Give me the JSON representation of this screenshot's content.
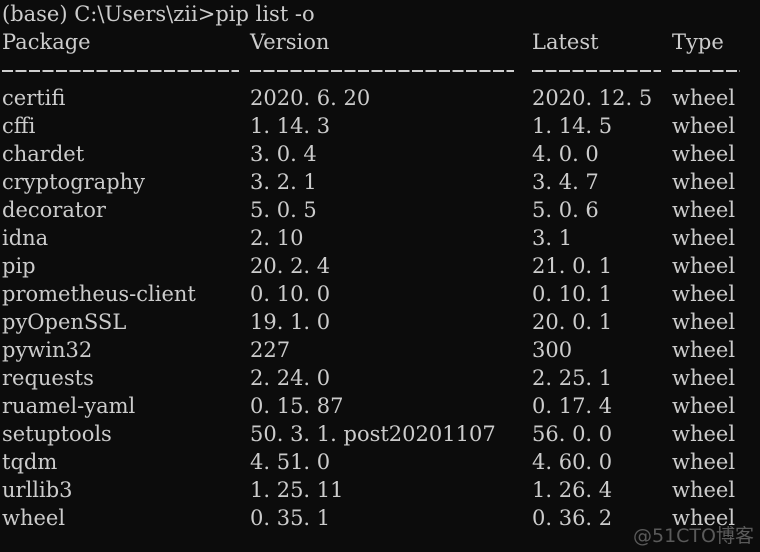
{
  "terminal": {
    "background_color": "#0c0c0c",
    "text_color": "#cccccc",
    "prompt_line": "(base) C:\\Users\\zii>pip list -o",
    "prompt_env": "(base)",
    "prompt_path": "C:\\Users\\zii",
    "command": "pip list -o"
  },
  "table": {
    "headers": {
      "package": "Package",
      "version": "Version",
      "latest": "Latest",
      "type": "Type"
    },
    "separators": {
      "package": "-------------------",
      "version": "---------------------",
      "latest": "----------",
      "type": "-----"
    },
    "rows": [
      {
        "package": "certifi",
        "version": "2020. 6. 20",
        "latest": "2020. 12. 5",
        "type": "wheel"
      },
      {
        "package": "cffi",
        "version": "1. 14. 3",
        "latest": "1. 14. 5",
        "type": "wheel"
      },
      {
        "package": "chardet",
        "version": "3. 0. 4",
        "latest": "4. 0. 0",
        "type": "wheel"
      },
      {
        "package": "cryptography",
        "version": "3. 2. 1",
        "latest": "3. 4. 7",
        "type": "wheel"
      },
      {
        "package": "decorator",
        "version": "5. 0. 5",
        "latest": "5. 0. 6",
        "type": "wheel"
      },
      {
        "package": "idna",
        "version": "2. 10",
        "latest": "3. 1",
        "type": "wheel"
      },
      {
        "package": "pip",
        "version": "20. 2. 4",
        "latest": "21. 0. 1",
        "type": "wheel"
      },
      {
        "package": "prometheus-client",
        "version": "0. 10. 0",
        "latest": "0. 10. 1",
        "type": "wheel"
      },
      {
        "package": "pyOpenSSL",
        "version": "19. 1. 0",
        "latest": "20. 0. 1",
        "type": "wheel"
      },
      {
        "package": "pywin32",
        "version": "227",
        "latest": "300",
        "type": "wheel"
      },
      {
        "package": "requests",
        "version": "2. 24. 0",
        "latest": "2. 25. 1",
        "type": "wheel"
      },
      {
        "package": "ruamel-yaml",
        "version": "0. 15. 87",
        "latest": "0. 17. 4",
        "type": "wheel"
      },
      {
        "package": "setuptools",
        "version": "50. 3. 1. post20201107",
        "latest": "56. 0. 0",
        "type": "wheel"
      },
      {
        "package": "tqdm",
        "version": "4. 51. 0",
        "latest": "4. 60. 0",
        "type": "wheel"
      },
      {
        "package": "urllib3",
        "version": "1. 25. 11",
        "latest": "1. 26. 4",
        "type": "wheel"
      },
      {
        "package": "wheel",
        "version": "0. 35. 1",
        "latest": "0. 36. 2",
        "type": "wheel"
      }
    ]
  },
  "watermark": {
    "text": "@51CTO博客",
    "color": "#5a5a5a"
  }
}
